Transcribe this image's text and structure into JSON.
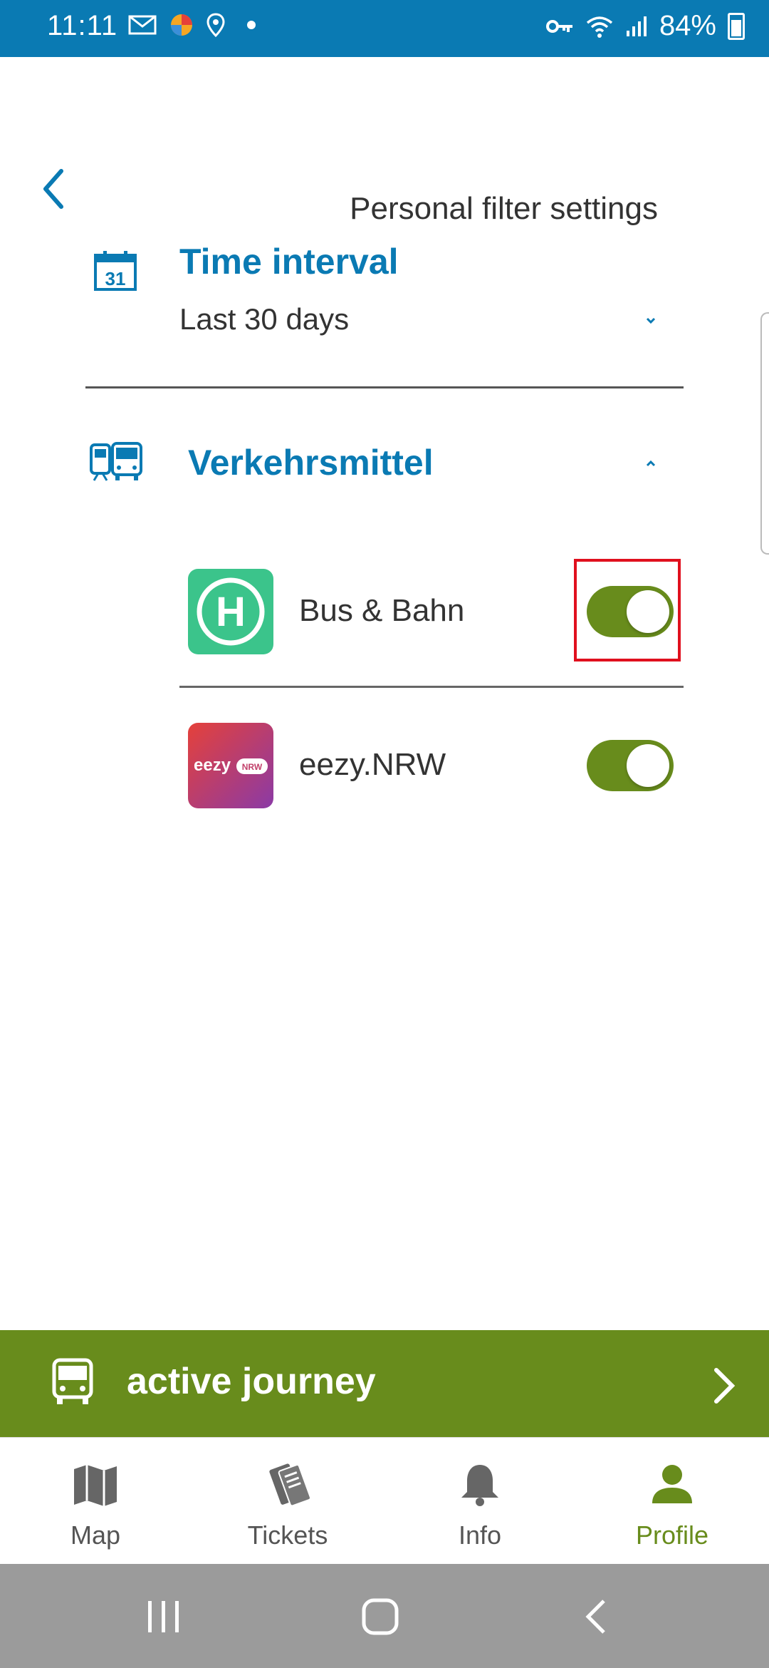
{
  "status_bar": {
    "time": "11:11",
    "battery": "84%"
  },
  "header": {
    "title": "Personal filter settings"
  },
  "time_interval": {
    "title": "Time interval",
    "value": "Last 30 days",
    "calendar_day": "31"
  },
  "transport": {
    "title": "Verkehrsmittel",
    "items": [
      {
        "label": "Bus & Bahn",
        "logo_letter": "H",
        "enabled": true
      },
      {
        "label": "eezy.NRW",
        "logo_text": "eezy",
        "logo_badge": "NRW",
        "enabled": true
      }
    ]
  },
  "active_journey": {
    "label": "active journey"
  },
  "bottom_nav": {
    "items": [
      {
        "label": "Map",
        "icon": "map-icon",
        "active": false
      },
      {
        "label": "Tickets",
        "icon": "tickets-icon",
        "active": false
      },
      {
        "label": "Info",
        "icon": "bell-icon",
        "active": false
      },
      {
        "label": "Profile",
        "icon": "profile-icon",
        "active": true
      }
    ]
  },
  "colors": {
    "primary_blue": "#0a7ab3",
    "accent_green": "#688c1c",
    "bus_bahn_green": "#3bc48b"
  }
}
